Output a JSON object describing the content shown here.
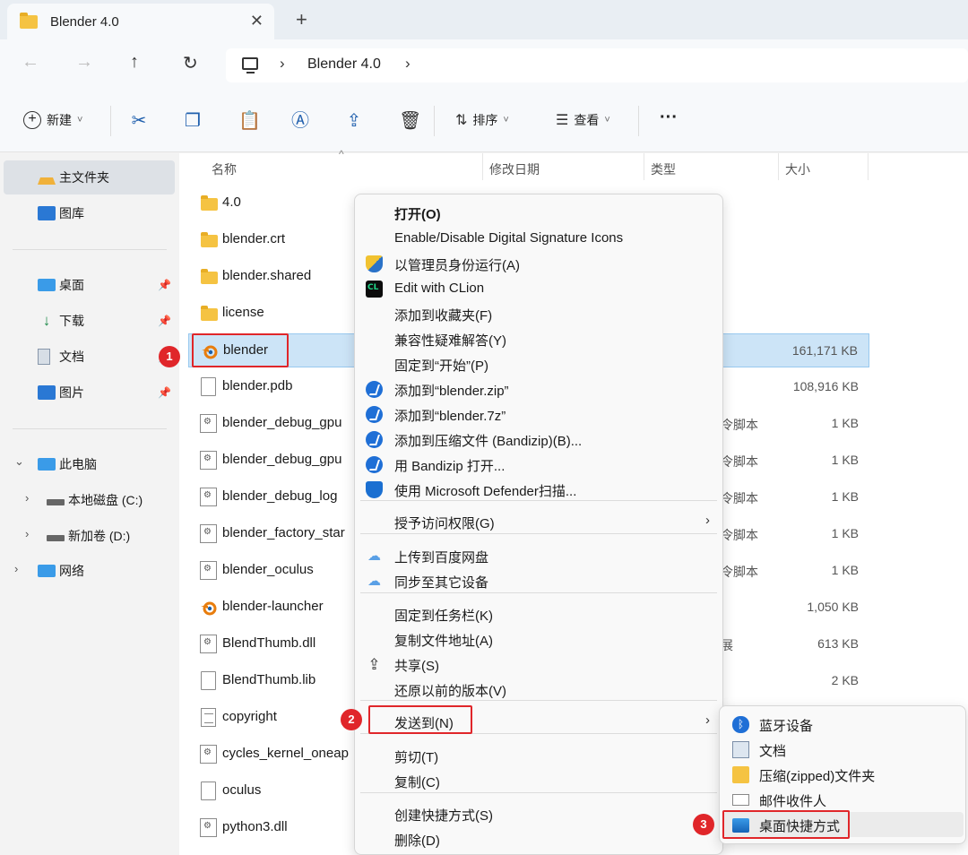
{
  "window": {
    "tab_title": "Blender 4.0",
    "close_glyph": "✕",
    "new_tab_glyph": "+"
  },
  "address": {
    "back_glyph": "←",
    "forward_glyph": "→",
    "up_glyph": "↑",
    "refresh_glyph": "↻",
    "crumb_sep": "›",
    "crumb_current": "Blender 4.0"
  },
  "toolbar": {
    "new_label": "新建",
    "sort_label": "排序",
    "view_label": "查看",
    "more_glyph": "···",
    "dropdown_glyph": "˅",
    "cut_glyph": "✂",
    "copy_glyph": "❐",
    "paste_glyph": "📋",
    "rename_glyph": "Ⓐ",
    "share_glyph": "⇪",
    "delete_glyph": "🗑"
  },
  "sidebar": {
    "home": "主文件夹",
    "gallery": "图库",
    "pinned": [
      {
        "label": "桌面"
      },
      {
        "label": "下载"
      },
      {
        "label": "文档"
      },
      {
        "label": "图片"
      }
    ],
    "pin_glyph": "📌",
    "this_pc": "此电脑",
    "drive_c": "本地磁盘 (C:)",
    "drive_d": "新加卷 (D:)",
    "network": "网络",
    "expanded_glyph": "⌄",
    "collapsed_glyph": "›"
  },
  "columns": {
    "name": "名称",
    "modified": "修改日期",
    "type": "类型",
    "size": "大小",
    "sort_glyph": "^"
  },
  "files": [
    {
      "name": "4.0",
      "icon": "folder-icon",
      "type": "",
      "size": ""
    },
    {
      "name": "blender.crt",
      "icon": "folder-icon",
      "type": "",
      "size": ""
    },
    {
      "name": "blender.shared",
      "icon": "folder-icon",
      "type": "",
      "size": ""
    },
    {
      "name": "license",
      "icon": "folder-icon",
      "type": "",
      "size": ""
    },
    {
      "name": "blender",
      "icon": "blender-icon",
      "type": "",
      "size": "161,171 KB"
    },
    {
      "name": "blender.pdb",
      "icon": "file-icon",
      "type": "",
      "size": "108,916 KB"
    },
    {
      "name": "blender_debug_gpu",
      "icon": "script-icon",
      "type": "令脚本",
      "size": "1 KB"
    },
    {
      "name": "blender_debug_gpu",
      "icon": "script-icon",
      "type": "令脚本",
      "size": "1 KB"
    },
    {
      "name": "blender_debug_log",
      "icon": "script-icon",
      "type": "令脚本",
      "size": "1 KB"
    },
    {
      "name": "blender_factory_star",
      "icon": "script-icon",
      "type": "令脚本",
      "size": "1 KB"
    },
    {
      "name": "blender_oculus",
      "icon": "script-icon",
      "type": "令脚本",
      "size": "1 KB"
    },
    {
      "name": "blender-launcher",
      "icon": "blender-icon",
      "type": "",
      "size": "1,050 KB"
    },
    {
      "name": "BlendThumb.dll",
      "icon": "script-icon",
      "type": "展",
      "size": "613 KB"
    },
    {
      "name": "BlendThumb.lib",
      "icon": "file-icon",
      "type": "",
      "size": "2 KB"
    },
    {
      "name": "copyright",
      "icon": "text-icon",
      "type": "",
      "size": ""
    },
    {
      "name": "cycles_kernel_oneap",
      "icon": "script-icon",
      "type": "",
      "size": ""
    },
    {
      "name": "oculus",
      "icon": "file-icon",
      "type": "",
      "size": ""
    },
    {
      "name": "python3.dll",
      "icon": "script-icon",
      "type": "",
      "size": ""
    }
  ],
  "callouts": [
    "1",
    "2",
    "3"
  ],
  "context_menu": {
    "items": [
      {
        "label": "打开(O)",
        "icon": ""
      },
      {
        "label": "Enable/Disable Digital Signature Icons",
        "icon": ""
      },
      {
        "label": "以管理员身份运行(A)",
        "icon": "uac-shield-icon"
      },
      {
        "label": "Edit with CLion",
        "icon": "clion-icon"
      },
      {
        "label": "添加到收藏夹(F)",
        "icon": ""
      },
      {
        "label": "兼容性疑难解答(Y)",
        "icon": ""
      },
      {
        "label": "固定到“开始”(P)",
        "icon": ""
      },
      {
        "label": "添加到“blender.zip”",
        "icon": "bandizip-icon"
      },
      {
        "label": "添加到“blender.7z”",
        "icon": "bandizip-icon"
      },
      {
        "label": "添加到压缩文件 (Bandizip)(B)...",
        "icon": "bandizip-icon"
      },
      {
        "label": "用 Bandizip 打开...",
        "icon": "bandizip-icon"
      },
      {
        "label": "使用 Microsoft Defender扫描...",
        "icon": "defender-icon"
      },
      {
        "label": "授予访问权限(G)",
        "icon": ""
      },
      {
        "label": "上传到百度网盘",
        "icon": "baidu-cloud-icon"
      },
      {
        "label": "同步至其它设备",
        "icon": "baidu-cloud-icon"
      },
      {
        "label": "固定到任务栏(K)",
        "icon": ""
      },
      {
        "label": "复制文件地址(A)",
        "icon": ""
      },
      {
        "label": "共享(S)",
        "icon": "share-icon"
      },
      {
        "label": "还原以前的版本(V)",
        "icon": ""
      },
      {
        "label": "发送到(N)",
        "icon": ""
      },
      {
        "label": "剪切(T)",
        "icon": ""
      },
      {
        "label": "复制(C)",
        "icon": ""
      },
      {
        "label": "创建快捷方式(S)",
        "icon": ""
      },
      {
        "label": "删除(D)",
        "icon": ""
      }
    ],
    "submenu_arrow": "›",
    "cloud_glyph": "☁",
    "share_glyph": "⇪"
  },
  "send_to_menu": {
    "items": [
      {
        "label": "蓝牙设备",
        "icon": "bluetooth-icon"
      },
      {
        "label": "文档",
        "icon": "documents-icon"
      },
      {
        "label": "压缩(zipped)文件夹",
        "icon": "zip-folder-icon"
      },
      {
        "label": "邮件收件人",
        "icon": "mail-icon"
      },
      {
        "label": "桌面快捷方式",
        "icon": "desktop-icon"
      }
    ],
    "bluetooth_glyph": "ᛒ"
  },
  "colors": {
    "accent": "#1f6fd6",
    "selection": "#cce4f7",
    "callout_red": "#e0262a"
  }
}
